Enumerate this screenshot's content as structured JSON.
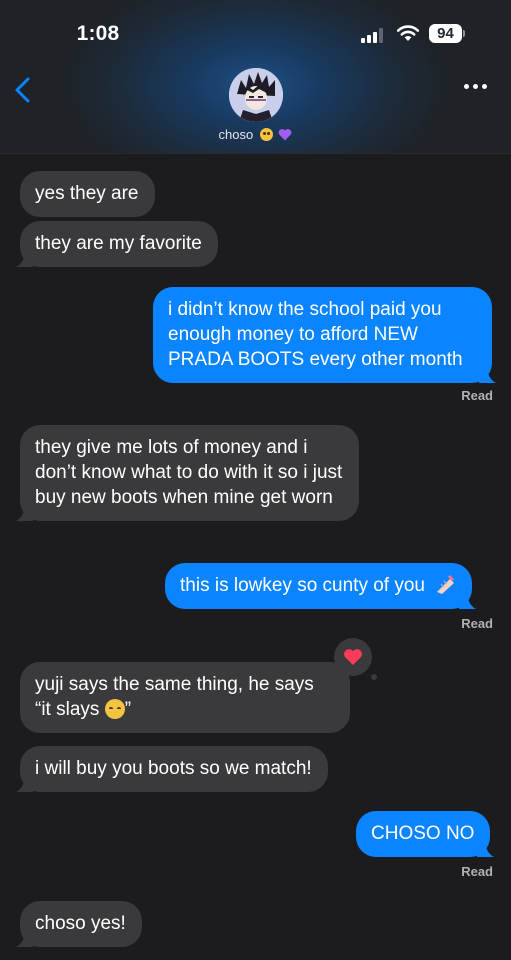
{
  "status_bar": {
    "time": "1:08",
    "battery": "94"
  },
  "header": {
    "contact_name": "choso",
    "name_emoji_1": "pleading-face-icon",
    "name_emoji_2": "purple-heart-icon"
  },
  "colors": {
    "incoming": "#3a3a3c",
    "outgoing": "#0a84ff",
    "background": "#1c1c1e",
    "tapback_heart": "#ff3b5c"
  },
  "messages": [
    {
      "from": "them",
      "text": "yes they are"
    },
    {
      "from": "them",
      "text": "they are my favorite"
    },
    {
      "from": "me",
      "text": "i didn’t know the school paid you enough money to afford NEW PRADA BOOTS every other month",
      "status": "Read"
    },
    {
      "from": "them",
      "text": "they give me lots of money and i don’t know what to do with it so i just buy new boots when mine get worn"
    },
    {
      "from": "me",
      "text": "this is lowkey so cunty of you",
      "emoji": "nail-polish-icon",
      "status": "Read"
    },
    {
      "from": "them",
      "text_a": "yuji says the same thing, he says “it slays",
      "text_b": "”",
      "emoji": "relieved-face-icon",
      "reaction": "heart"
    },
    {
      "from": "them",
      "text": "i will buy you boots so we match!"
    },
    {
      "from": "me",
      "text": "CHOSO NO",
      "status": "Read"
    },
    {
      "from": "them",
      "text": "choso yes!"
    }
  ]
}
